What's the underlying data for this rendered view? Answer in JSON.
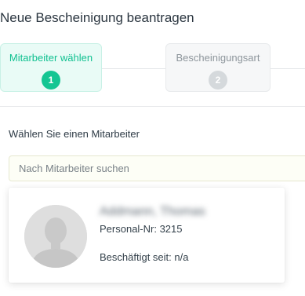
{
  "page": {
    "title": "Neue Bescheinigung beantragen"
  },
  "stepper": {
    "steps": [
      {
        "label": "Mitarbeiter wählen",
        "number": "1",
        "active": true
      },
      {
        "label": "Bescheinigungsart",
        "number": "2",
        "active": false
      }
    ]
  },
  "employee_select": {
    "label": "Wählen Sie einen Mitarbeiter",
    "search_placeholder": "Nach Mitarbeiter suchen",
    "search_value": ""
  },
  "employee_card": {
    "name": "Addmann, Thomas",
    "personal_nr": "Personal-Nr: 3215",
    "employed_since": "Beschäftigt seit: n/a"
  },
  "colors": {
    "accent": "#14c693",
    "inactive_step": "#d5d9dc"
  },
  "icons": {
    "avatar": "default-person-avatar"
  }
}
